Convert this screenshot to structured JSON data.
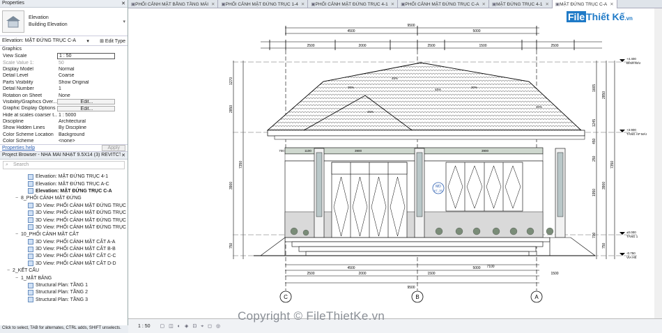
{
  "properties": {
    "title": "Properties",
    "type_name": "Elevation",
    "type_sub": "Building Elevation",
    "instance": "Elevation: MẶT ĐỨNG TRỤC C-A",
    "edit_type": "Edit Type",
    "group": "Graphics",
    "rows": [
      {
        "k": "View Scale",
        "v": "1 : 50"
      },
      {
        "k": "Scale Value    1:",
        "v": "50"
      },
      {
        "k": "Display Model",
        "v": "Normal"
      },
      {
        "k": "Detail Level",
        "v": "Coarse"
      },
      {
        "k": "Parts Visibility",
        "v": "Show Original"
      },
      {
        "k": "Detail Number",
        "v": "1"
      },
      {
        "k": "Rotation on Sheet",
        "v": "None"
      },
      {
        "k": "Visibility/Graphics Over...",
        "v": "Edit..."
      },
      {
        "k": "Graphic Display Options",
        "v": "Edit..."
      },
      {
        "k": "Hide at scales coarser t...",
        "v": "1 : 5000"
      },
      {
        "k": "Discipline",
        "v": "Architectural"
      },
      {
        "k": "Show Hidden Lines",
        "v": "By Discipline"
      },
      {
        "k": "Color Scheme Location",
        "v": "Background"
      },
      {
        "k": "Color Scheme",
        "v": "<none>"
      }
    ],
    "help": "Properties help",
    "apply": "Apply"
  },
  "browser": {
    "title": "Project Browser - NHÀ MÁI NHẬT 9.5X14 (3) REVITCT...",
    "search_placeholder": "Search",
    "items": [
      {
        "label": "Elevation: MẶT ĐỨNG TRỤC 4-1",
        "indent": 40,
        "icon": true
      },
      {
        "label": "Elevation: MẶT ĐỨNG TRỤC A-C",
        "indent": 40,
        "icon": true
      },
      {
        "label": "Elevation: MẶT ĐỨNG TRỤC C-A",
        "indent": 40,
        "icon": true,
        "bold": true
      },
      {
        "label": "8_PHỐI CẢNH MẶT ĐỨNG",
        "indent": 22,
        "toggle": "−"
      },
      {
        "label": "3D View: PHỐI CẢNH MẶT ĐỨNG TRỤC",
        "indent": 40,
        "icon": true
      },
      {
        "label": "3D View: PHỐI CẢNH MẶT ĐỨNG TRỤC",
        "indent": 40,
        "icon": true
      },
      {
        "label": "3D View: PHỐI CẢNH MẶT ĐỨNG TRỤC",
        "indent": 40,
        "icon": true
      },
      {
        "label": "3D View: PHỐI CẢNH MẶT ĐỨNG TRỤC",
        "indent": 40,
        "icon": true
      },
      {
        "label": "10_PHỐI CẢNH MẶT CẮT",
        "indent": 22,
        "toggle": "−"
      },
      {
        "label": "3D View: PHỐI CẢNH MẶT CẮT A-A",
        "indent": 40,
        "icon": true
      },
      {
        "label": "3D View: PHỐI CẢNH MẶT CẮT B-B",
        "indent": 40,
        "icon": true
      },
      {
        "label": "3D View: PHỐI CẢNH MẶT CẮT C-C",
        "indent": 40,
        "icon": true
      },
      {
        "label": "3D View: PHỐI CẢNH MẶT CẮT D-D",
        "indent": 40,
        "icon": true
      },
      {
        "label": "2_KẾT CẤU",
        "indent": 10,
        "toggle": "−"
      },
      {
        "label": "1_MẶT BẰNG",
        "indent": 22,
        "toggle": "−"
      },
      {
        "label": "Structural Plan: TẦNG 1",
        "indent": 40,
        "icon": true
      },
      {
        "label": "Structural Plan: TẦNG 2",
        "indent": 40,
        "icon": true
      },
      {
        "label": "Structural Plan: TẦNG 3",
        "indent": 40,
        "icon": true
      }
    ]
  },
  "tabs": [
    {
      "label": "PHỐI CẢNH MẶT BẰNG TẦNG MÁI"
    },
    {
      "label": "PHỐI CẢNH MẶT ĐỨNG TRỤC 1-4"
    },
    {
      "label": "PHỐI CẢNH MẶT ĐỨNG TRỤC 4-1"
    },
    {
      "label": "PHỐI CẢNH MẶT ĐỨNG TRỤC C-A"
    },
    {
      "label": "MẶT ĐỨNG TRỤC 4-1"
    },
    {
      "label": "MẶT ĐỨNG TRỤC C-A",
      "active": true
    }
  ],
  "status": {
    "scale": "1 : 50",
    "hint": "Click to select, TAB for alternates, CTRL adds, SHIFT unselects."
  },
  "logo": {
    "a": "File",
    "b": "Thiết Kế",
    "c": ".vn"
  },
  "watermark": "Copyright © FileThietKe.vn",
  "drawing": {
    "grid_labels": [
      "C",
      "B",
      "A"
    ],
    "overall_width": "9500",
    "dims_top": [
      "4500",
      "5000"
    ],
    "dims_top2": [
      "2500",
      "2000",
      "2500",
      "1500",
      "2500"
    ],
    "dims_bottom": [
      "4500",
      "5000"
    ],
    "dims_bottom2": [
      "2500",
      "2000",
      "1500",
      "2500",
      "1500"
    ],
    "dims_bottom3": [
      "7100"
    ],
    "level_labels": [
      {
        "t": "+4.400",
        "s": "ĐỈNH MÁI"
      },
      {
        "t": "+3.900",
        "s": "TẦNG ÁP MÁI"
      },
      {
        "t": "±0.000",
        "s": "TẦNG 1"
      },
      {
        "t": "-0.750",
        "s": "VỈA HÈ"
      }
    ],
    "dims_right": [
      "1665",
      "1245",
      "450",
      "250",
      "1950",
      "700",
      "150",
      "150"
    ],
    "dims_right2": [
      "2850",
      "3900",
      "750"
    ],
    "dims_right3": [
      "7350"
    ],
    "dims_left": [
      "1270",
      "2850",
      "3900",
      "750"
    ],
    "dims_left2": [
      "7350"
    ],
    "beam_dims": [
      "700",
      "1100",
      "3900",
      "3900"
    ],
    "slopes": [
      "30%",
      "45%",
      "45%",
      "30%",
      "45%",
      "30%"
    ],
    "tag": {
      "a": "MD",
      "b": "KT_3S"
    }
  }
}
